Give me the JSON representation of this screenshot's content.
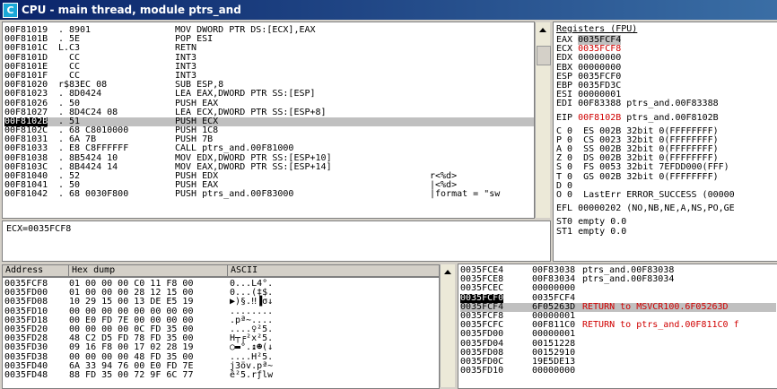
{
  "window": {
    "icon_letter": "C",
    "title": "CPU - main thread, module ptrs_and"
  },
  "disasm": {
    "rows": [
      {
        "addr": "00F81019",
        "mark": " . ",
        "hex": "8901",
        "inst": "MOV DWORD PTR DS:[ECX],EAX",
        "comment": ""
      },
      {
        "addr": "00F8101B",
        "mark": " . ",
        "hex": "5E",
        "inst": "POP ESI",
        "comment": ""
      },
      {
        "addr": "00F8101C",
        "mark": " L.",
        "hex": "C3",
        "inst": "RETN",
        "comment": ""
      },
      {
        "addr": "00F8101D",
        "mark": "   ",
        "hex": "CC",
        "inst": "INT3",
        "comment": ""
      },
      {
        "addr": "00F8101E",
        "mark": "   ",
        "hex": "CC",
        "inst": "INT3",
        "comment": ""
      },
      {
        "addr": "00F8101F",
        "mark": "   ",
        "hex": "CC",
        "inst": "INT3",
        "comment": ""
      },
      {
        "addr": "00F81020",
        "mark": " r$",
        "hex": "83EC 08",
        "inst": "SUB ESP,8",
        "comment": ""
      },
      {
        "addr": "00F81023",
        "mark": " . ",
        "hex": "8D0424",
        "inst": "LEA EAX,DWORD PTR SS:[ESP]",
        "comment": ""
      },
      {
        "addr": "00F81026",
        "mark": " . ",
        "hex": "50",
        "inst": "PUSH EAX",
        "comment": ""
      },
      {
        "addr": "00F81027",
        "mark": " . ",
        "hex": "8D4C24 08",
        "inst": "LEA ECX,DWORD PTR SS:[ESP+8]",
        "comment": ""
      },
      {
        "addr": "00F8102B",
        "mark": " . ",
        "hex": "51",
        "inst": "PUSH ECX",
        "comment": ""
      },
      {
        "addr": "00F8102C",
        "mark": " . ",
        "hex": "68 C8010000",
        "inst": "PUSH 1C8",
        "comment": ""
      },
      {
        "addr": "00F81031",
        "mark": " . ",
        "hex": "6A 7B",
        "inst": "PUSH 7B",
        "comment": ""
      },
      {
        "addr": "00F81033",
        "mark": " . ",
        "hex": "E8 C8FFFFFF",
        "inst": "CALL ptrs_and.00F81000",
        "comment": ""
      },
      {
        "addr": "00F81038",
        "mark": " . ",
        "hex": "8B5424 10",
        "inst": "MOV EDX,DWORD PTR SS:[ESP+10]",
        "comment": ""
      },
      {
        "addr": "00F8103C",
        "mark": " . ",
        "hex": "8B4424 14",
        "inst": "MOV EAX,DWORD PTR SS:[ESP+14]",
        "comment": ""
      },
      {
        "addr": "00F81040",
        "mark": " . ",
        "hex": "52",
        "inst": "PUSH EDX",
        "comment": "r<%d>"
      },
      {
        "addr": "00F81041",
        "mark": " . ",
        "hex": "50",
        "inst": "PUSH EAX",
        "comment": "|<%d>"
      },
      {
        "addr": "00F81042",
        "mark": " . ",
        "hex": "68 0030F800",
        "inst": "PUSH ptrs_and.00F83000",
        "comment": "|format = \"sw"
      }
    ]
  },
  "info_line": "ECX=0035FCF8",
  "registers": {
    "header": "Registers (FPU)",
    "lines": [
      "EAX 0035FCF4",
      "ECX 0035FCF8",
      "EDX 00000000",
      "EBX 00000000",
      "ESP 0035FCF0",
      "EBP 0035FD3C",
      "ESI 00000001",
      "EDI 00F83388 ptrs_and.00F83388",
      "",
      "EIP 00F8102B ptrs_and.00F8102B",
      "",
      "C 0  ES 002B 32bit 0(FFFFFFFF)",
      "P 0  CS 0023 32bit 0(FFFFFFFF)",
      "A 0  SS 002B 32bit 0(FFFFFFFF)",
      "Z 0  DS 002B 32bit 0(FFFFFFFF)",
      "S 0  FS 0053 32bit 7EFDD000(FFF)",
      "T 0  GS 002B 32bit 0(FFFFFFFF)",
      "D 0",
      "O 0  LastErr ERROR_SUCCESS (00000",
      "",
      "EFL 00000202 (NO,NB,NE,A,NS,PO,GE",
      "",
      "ST0 empty 0.0",
      "ST1 empty 0.0"
    ]
  },
  "dump": {
    "col_address": "Address",
    "col_hex": "Hex dump",
    "col_ascii": "ASCII",
    "rows": [
      {
        "addr": "0035FCF8",
        "hex": "01 00 00 00 C0 11 F8 00",
        "ascii": "0...L4°."
      },
      {
        "addr": "0035FD00",
        "hex": "01 00 00 00 28 12 15 00",
        "ascii": "0...(‡$."
      },
      {
        "addr": "0035FD08",
        "hex": "10 29 15 00 13 DE E5 19",
        "ascii": "▶)§.‼▐σ↓"
      },
      {
        "addr": "0035FD10",
        "hex": "00 00 00 00 00 00 00 00",
        "ascii": "........"
      },
      {
        "addr": "0035FD18",
        "hex": "00 E0 FD 7E 00 00 00 00",
        "ascii": ".pª~...."
      },
      {
        "addr": "0035FD20",
        "hex": "00 00 00 00 0C FD 35 00",
        "ascii": "....♀²5."
      },
      {
        "addr": "0035FD28",
        "hex": "48 C2 D5 FD 78 FD 35 00",
        "ascii": "H┬╒²x²5."
      },
      {
        "addr": "0035FD30",
        "hex": "09 16 F8 00 17 02 28 19",
        "ascii": "○▬°.↨☻(↓"
      },
      {
        "addr": "0035FD38",
        "hex": "00 00 00 00 48 FD 35 00",
        "ascii": "....H²5."
      },
      {
        "addr": "0035FD40",
        "hex": "6A 33 94 76 00 E0 FD 7E",
        "ascii": "j3öv.pª~"
      },
      {
        "addr": "0035FD48",
        "hex": "88 FD 35 00 72 9F 6C 77",
        "ascii": "ê²5.rƒlw"
      }
    ]
  },
  "stack": {
    "rows": [
      {
        "addr": "0035FCE4",
        "val": "00F83038",
        "comment": "ptrs_and.00F83038"
      },
      {
        "addr": "0035FCE8",
        "val": "00F83034",
        "comment": "ptrs_and.00F83034"
      },
      {
        "addr": "0035FCEC",
        "val": "00000000",
        "comment": ""
      },
      {
        "addr": "0035FCF0",
        "val": "0035FCF4",
        "comment": ""
      },
      {
        "addr": "0035FCF4",
        "val": "6F05263D",
        "comment": "RETURN to MSVCR100.6F05263D"
      },
      {
        "addr": "0035FCF8",
        "val": "00000001",
        "comment": ""
      },
      {
        "addr": "0035FCFC",
        "val": "00F811C0",
        "comment": "RETURN to ptrs_and.00F811C0 f"
      },
      {
        "addr": "0035FD00",
        "val": "00000001",
        "comment": ""
      },
      {
        "addr": "0035FD04",
        "val": "00151228",
        "comment": ""
      },
      {
        "addr": "0035FD08",
        "val": "00152910",
        "comment": ""
      },
      {
        "addr": "0035FD0C",
        "val": "19E5DE13",
        "comment": ""
      },
      {
        "addr": "0035FD10",
        "val": "00000000",
        "comment": ""
      }
    ]
  },
  "colors": {
    "title_bg": "#0a246a",
    "highlight_red": "#d00000",
    "selection": "#c0c0c0"
  }
}
